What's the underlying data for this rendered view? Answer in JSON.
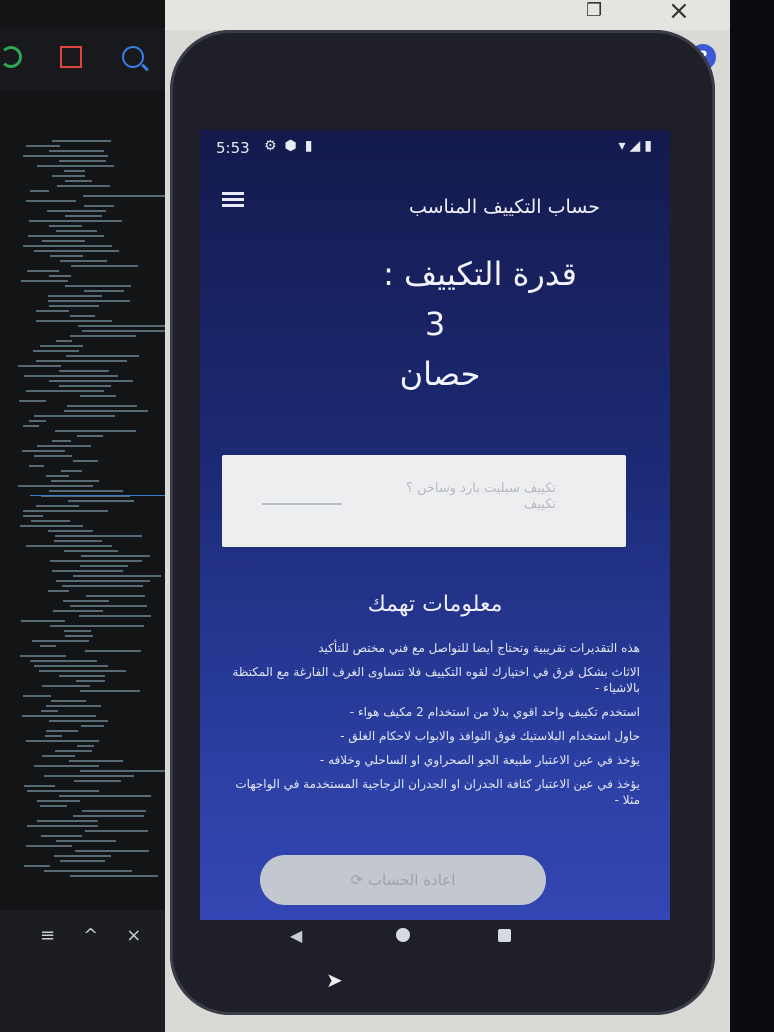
{
  "status_bar": {
    "time": "5:53"
  },
  "app": {
    "title": "حساب التكييف المناسب",
    "menu_icon": "hamburger-menu-icon"
  },
  "result": {
    "label": "قدرة التكييف :",
    "value": "3",
    "unit": "حصان"
  },
  "input": {
    "placeholder_lines": [
      "تكييف سبليت بارد وساخن ؟",
      "تكييف"
    ]
  },
  "info": {
    "title": "معلومات تهمك",
    "items": [
      "هذه التقديرات تقريبية وتحتاج أيضا للتواصل مع فني مختص للتأكيد",
      "الاثاث بشكل فرق في اختيارك لقوه التكييف فلا تتساوى الغرف الفارغة مع المكتظة بالاشياء -",
      "استخدم تكييف واحد اقوي بدلا من استخدام 2 مكيف هواء -",
      "حاول استخدام البلاستيك فوق النوافذ والابواب لاحكام الغلق -",
      "يؤخذ في عين الاعتبار طبيعة الجو الصحراوي او الساحلي وخلافه -",
      "يؤخذ في عين الاعتبار كثافة الجدران او الجدران الزجاجية المستخدمة في الواجهات مثلا -"
    ]
  },
  "recalc_button": {
    "label": "اعادة الحساب"
  },
  "ide": {
    "bottom_icons": [
      "≡",
      "^",
      "×"
    ]
  },
  "window": {
    "help_label": "?"
  },
  "colors": {
    "screen_top": "#141a4c",
    "screen_bottom": "#3346b3",
    "input_bg": "#eceef0",
    "button_bg": "#c3c7cf"
  }
}
